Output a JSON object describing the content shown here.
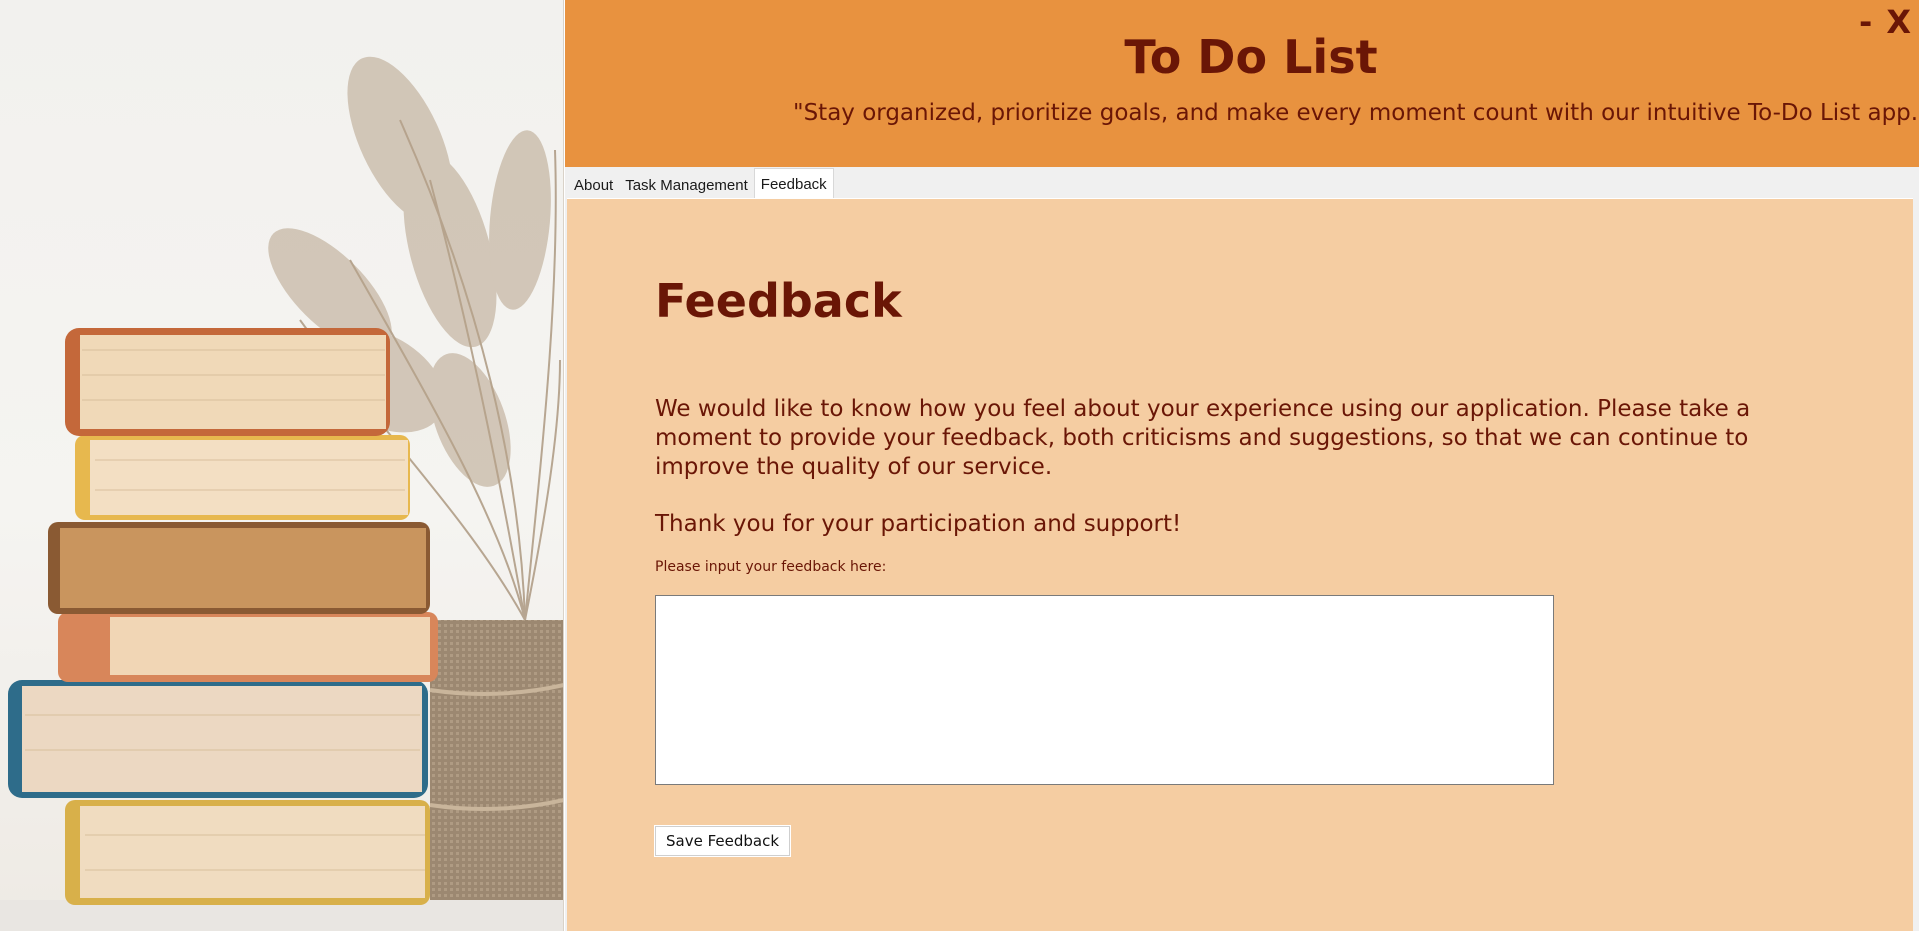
{
  "window": {
    "minimize_label": "-",
    "close_label": "X"
  },
  "header": {
    "title": "To Do List",
    "subtitle": "\"Stay organized, prioritize goals, and make every moment count with our intuitive To-Do List app.\""
  },
  "tabs": [
    {
      "label": "About",
      "active": false
    },
    {
      "label": "Task Management",
      "active": false
    },
    {
      "label": "Feedback",
      "active": true
    }
  ],
  "feedback": {
    "heading": "Feedback",
    "intro": "We would like to know how you feel about your experience using our application. Please take a moment to provide your feedback, both criticisms and suggestions, so that we can continue to improve the quality of our service.",
    "thanks": "Thank you for your participation and support!",
    "input_label": "Please input your feedback here:",
    "input_value": "",
    "save_label": "Save Feedback"
  },
  "colors": {
    "header_bg": "#e8923f",
    "content_bg": "#f5cda2",
    "text_dark": "#6a1606"
  },
  "side_image": {
    "description_icon": "books-stack-with-dried-grass-image"
  }
}
